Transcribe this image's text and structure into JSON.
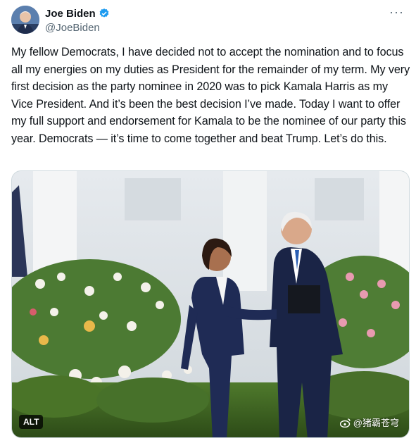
{
  "author": {
    "display_name": "Joe Biden",
    "handle": "@JoeBiden",
    "verified_icon": "verified-badge-icon",
    "avatar_icon": "profile-avatar"
  },
  "more_label": "···",
  "post": {
    "text": "My fellow Democrats, I have decided not to accept the nomination and to focus all my energies on my duties as President for the remainder of my term. My very first decision as the party nominee in 2020 was to pick Kamala Harris as my Vice President. And it’s been the best decision I’ve made. Today I want to offer my full support and endorsement for Kamala to be the nominee of our party this year. Democrats — it’s time to come together and beat Trump. Let’s do this."
  },
  "media": {
    "alt_label": "ALT",
    "watermark": "@猪霸苍穹"
  },
  "colors": {
    "verified": "#1d9bf0",
    "secondary_text": "#536471",
    "border": "#cfd9de"
  }
}
